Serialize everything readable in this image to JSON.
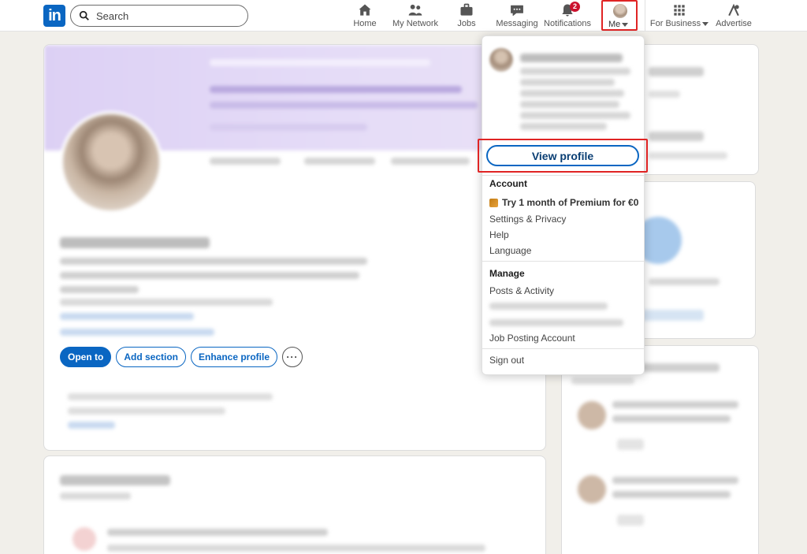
{
  "topbar": {
    "logo": "in",
    "search_placeholder": "Search",
    "nav": [
      {
        "label": "Home",
        "icon": "home-icon"
      },
      {
        "label": "My Network",
        "icon": "network-icon"
      },
      {
        "label": "Jobs",
        "icon": "briefcase-icon"
      },
      {
        "label": "Messaging",
        "icon": "messaging-icon"
      },
      {
        "label": "Notifications",
        "icon": "bell-icon",
        "badge": "2"
      },
      {
        "label": "Me",
        "icon": "avatar"
      },
      {
        "label": "For Business",
        "icon": "grid-icon"
      },
      {
        "label": "Advertise",
        "icon": "advertise-icon"
      }
    ]
  },
  "profile": {
    "buttons": {
      "open_to": "Open to",
      "add_section": "Add section",
      "enhance_profile": "Enhance profile",
      "more": "···"
    }
  },
  "dropdown": {
    "view_profile": "View profile",
    "account_title": "Account",
    "premium": "Try 1 month of Premium for €0",
    "settings": "Settings & Privacy",
    "help": "Help",
    "language": "Language",
    "manage_title": "Manage",
    "posts": "Posts & Activity",
    "job_posting": "Job Posting Account",
    "sign_out": "Sign out"
  },
  "colors": {
    "brand": "#0a66c2",
    "highlight": "#e02424",
    "badge": "#cb112d",
    "banner": "#dcd0f4"
  }
}
